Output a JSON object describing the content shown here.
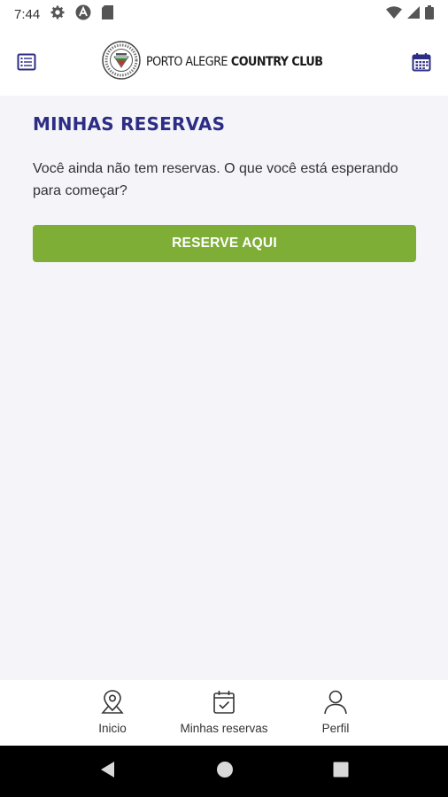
{
  "status_bar": {
    "time": "7:44",
    "icons": [
      "gear-icon",
      "app-icon",
      "sd-card-icon",
      "wifi-icon",
      "signal-icon",
      "battery-icon"
    ]
  },
  "header": {
    "left_icon": "list-icon",
    "right_icon": "calendar-icon",
    "logo_text_light": "PORTO ALEGRE",
    "logo_text_bold": "COUNTRY CLUB"
  },
  "main": {
    "title": "MINHAS RESERVAS",
    "empty_message": "Você ainda não tem reservas. O que você está esperando para começar?",
    "reserve_button": "RESERVE AQUI"
  },
  "bottom_nav": {
    "items": [
      {
        "label": "Inicio",
        "icon": "map-pin-icon"
      },
      {
        "label": "Minhas reservas",
        "icon": "calendar-check-icon"
      },
      {
        "label": "Perfil",
        "icon": "user-icon"
      }
    ]
  },
  "system_nav": {
    "icons": [
      "back-icon",
      "home-icon",
      "recents-icon"
    ]
  },
  "colors": {
    "title": "#2d2d86",
    "button": "#7fae37",
    "background": "#f4f4f9",
    "icon_navy": "#2d2d86"
  }
}
